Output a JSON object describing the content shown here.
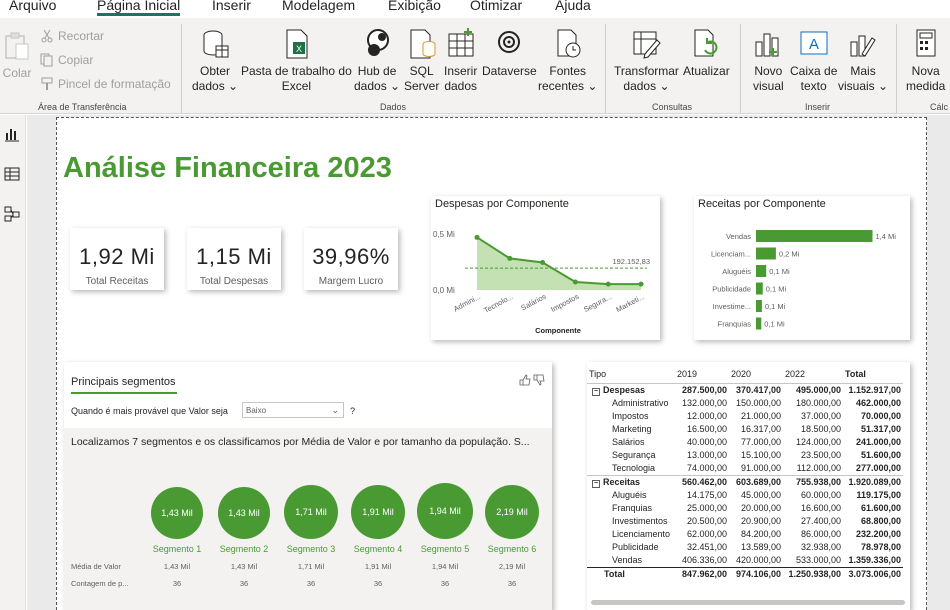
{
  "menu": {
    "tabs": [
      "Arquivo",
      "Página Inicial",
      "Inserir",
      "Modelagem",
      "Exibição",
      "Otimizar",
      "Ajuda"
    ],
    "active_tab": "Página Inicial"
  },
  "ribbon": {
    "clipboard": {
      "paste_label": "Colar",
      "cut_label": "Recortar",
      "copy_label": "Copiar",
      "format_painter_label": "Pincel de formatação",
      "group_label": "Área de Transferência"
    },
    "data": {
      "get_data": [
        "Obter",
        "dados"
      ],
      "excel": [
        "Pasta de trabalho do",
        "Excel"
      ],
      "hub": [
        "Hub de",
        "dados"
      ],
      "sql": [
        "SQL",
        "Server"
      ],
      "enter": [
        "Inserir",
        "dados"
      ],
      "dataverse": [
        "Dataverse",
        ""
      ],
      "recent": [
        "Fontes",
        "recentes"
      ],
      "group_label": "Dados"
    },
    "queries": {
      "transform": [
        "Transformar",
        "dados"
      ],
      "refresh": [
        "Atualizar",
        ""
      ],
      "group_label": "Consultas"
    },
    "insert": {
      "new_visual": [
        "Novo",
        "visual"
      ],
      "text_box": [
        "Caixa de",
        "texto"
      ],
      "more_visuals": [
        "Mais",
        "visuais"
      ],
      "group_label": "Inserir"
    },
    "calc": {
      "new_measure": [
        "Nova",
        "medida"
      ],
      "group_label": "Cálc"
    }
  },
  "report": {
    "title": "Análise Financeira 2023",
    "kpis": [
      {
        "value": "1,92 Mi",
        "label": "Total Receitas"
      },
      {
        "value": "1,15 Mi",
        "label": "Total Despesas"
      },
      {
        "value": "39,96%",
        "label": "Margem Lucro"
      }
    ]
  },
  "colors": {
    "accent_green": "#4a9a33",
    "area_fill": "#b8dca6",
    "active_tab_underline": "#117865"
  },
  "chart_data": [
    {
      "type": "area",
      "title": "Despesas por Componente",
      "xlabel": "Componente",
      "ylabel": "",
      "categories": [
        "Admini...",
        "Tecnolo...",
        "Salários",
        "Impostos",
        "Segura...",
        "Marketi..."
      ],
      "values": [
        462000,
        277000,
        241000,
        70000,
        51600,
        51317
      ],
      "y_ticks": [
        "0,5 Mi",
        "0,0 Mi"
      ],
      "ylim": [
        0,
        500000
      ],
      "average_line": {
        "value": 192152.83,
        "label": "192.152,83"
      }
    },
    {
      "type": "bar",
      "orientation": "horizontal",
      "title": "Receitas por Componente",
      "categories": [
        "Vendas",
        "Licenciam...",
        "Aluguéis",
        "Publicidade",
        "Investime...",
        "Franquias"
      ],
      "values": [
        1359336,
        232200,
        119175,
        78978,
        68800,
        61600
      ],
      "data_labels": [
        "1,4 Mi",
        "0,2 Mi",
        "0,1 Mi",
        "0,1 Mi",
        "0,1 Mi",
        "0,1 Mi"
      ],
      "xlim": [
        0,
        1400000
      ]
    }
  ],
  "segments": {
    "title": "Principais segmentos",
    "question": "Quando é mais provável que Valor seja",
    "dropdown_value": "Baixo",
    "question_mark": "?",
    "description": "Localizamos 7 segmentos e os classificamos por Média de Valor e por tamanho da população. S...",
    "row_labels": [
      "Média de Valor",
      "Contagem de p..."
    ],
    "items": [
      {
        "name": "Segmento 1",
        "bubble": "1,43 Mil",
        "media": "1,43 Mil",
        "count": "36"
      },
      {
        "name": "Segmento 2",
        "bubble": "1,43 Mil",
        "media": "1,43 Mil",
        "count": "36"
      },
      {
        "name": "Segmento 3",
        "bubble": "1,71 Mil",
        "media": "1,71 Mil",
        "count": "36"
      },
      {
        "name": "Segmento 4",
        "bubble": "1,91 Mil",
        "media": "1,91 Mil",
        "count": "36"
      },
      {
        "name": "Segmento 5",
        "bubble": "1,94 Mil",
        "media": "1,94 Mil",
        "count": "36"
      },
      {
        "name": "Segmento 6",
        "bubble": "2,19 Mil",
        "media": "2,19 Mil",
        "count": "36"
      }
    ]
  },
  "matrix": {
    "headers": [
      "Tipo",
      "2019",
      "2020",
      "2022",
      "Total"
    ],
    "groups": [
      {
        "name": "Despesas",
        "values": [
          "287.500,00",
          "370.417,00",
          "495.000,00",
          "1.152.917,00"
        ],
        "rows": [
          {
            "name": "Administrativo",
            "values": [
              "132.000,00",
              "150.000,00",
              "180.000,00",
              "462.000,00"
            ]
          },
          {
            "name": "Impostos",
            "values": [
              "12.000,00",
              "21.000,00",
              "37.000,00",
              "70.000,00"
            ]
          },
          {
            "name": "Marketing",
            "values": [
              "16.500,00",
              "16.317,00",
              "18.500,00",
              "51.317,00"
            ]
          },
          {
            "name": "Salários",
            "values": [
              "40.000,00",
              "77.000,00",
              "124.000,00",
              "241.000,00"
            ]
          },
          {
            "name": "Segurança",
            "values": [
              "13.000,00",
              "15.100,00",
              "23.500,00",
              "51.600,00"
            ]
          },
          {
            "name": "Tecnologia",
            "values": [
              "74.000,00",
              "91.000,00",
              "112.000,00",
              "277.000,00"
            ]
          }
        ]
      },
      {
        "name": "Receitas",
        "values": [
          "560.462,00",
          "603.689,00",
          "755.938,00",
          "1.920.089,00"
        ],
        "rows": [
          {
            "name": "Aluguéis",
            "values": [
              "14.175,00",
              "45.000,00",
              "60.000,00",
              "119.175,00"
            ]
          },
          {
            "name": "Franquias",
            "values": [
              "25.000,00",
              "20.000,00",
              "16.600,00",
              "61.600,00"
            ]
          },
          {
            "name": "Investimentos",
            "values": [
              "20.500,00",
              "20.900,00",
              "27.400,00",
              "68.800,00"
            ]
          },
          {
            "name": "Licenciamento",
            "values": [
              "62.000,00",
              "84.200,00",
              "86.000,00",
              "232.200,00"
            ]
          },
          {
            "name": "Publicidade",
            "values": [
              "32.451,00",
              "13.589,00",
              "32.938,00",
              "78.978,00"
            ]
          },
          {
            "name": "Vendas",
            "values": [
              "406.336,00",
              "420.000,00",
              "533.000,00",
              "1.359.336,00"
            ]
          }
        ]
      }
    ],
    "total": {
      "name": "Total",
      "values": [
        "847.962,00",
        "974.106,00",
        "1.250.938,00",
        "3.073.006,00"
      ]
    }
  }
}
